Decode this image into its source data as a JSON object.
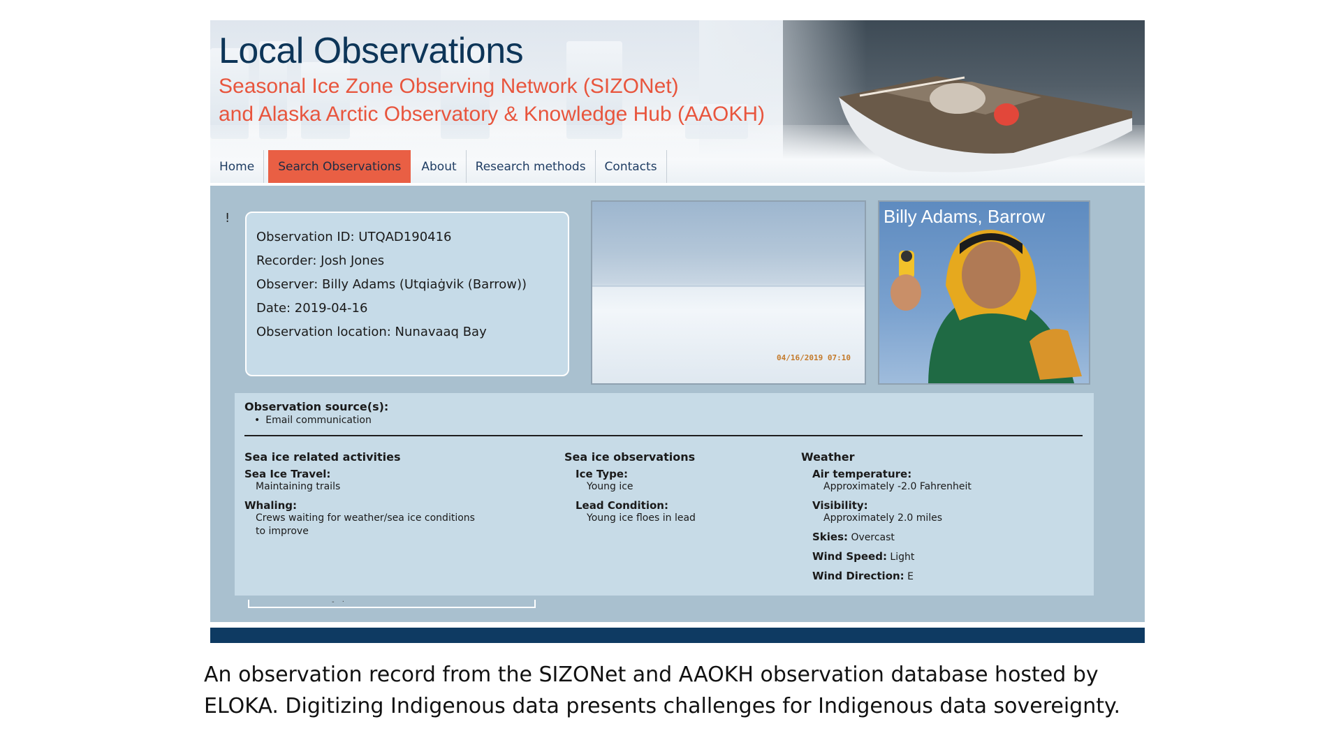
{
  "banner": {
    "title": "Local Observations",
    "subtitle_line1": "Seasonal Ice Zone Observing Network (SIZONet)",
    "subtitle_line2": "and Alaska Arctic Observatory & Knowledge Hub (AAOKH)"
  },
  "nav": {
    "items": [
      {
        "label": "Home"
      },
      {
        "label": "Search Observations",
        "active": true
      },
      {
        "label": "About"
      },
      {
        "label": "Research methods"
      },
      {
        "label": "Contacts"
      }
    ],
    "active_color": "#e95f44"
  },
  "stray_text": "!",
  "record": {
    "id": "Observation ID: UTQAD190416",
    "recorder": "Recorder: Josh Jones",
    "observer": "Observer: Billy Adams (Utqiaġvik (Barrow))",
    "date": "Date: 2019-04-16",
    "location": "Observation location: Nunavaaq Bay"
  },
  "photos": {
    "ice_timestamp": "04/16/2019 07:10",
    "person_caption": "Billy Adams, Barrow"
  },
  "sources": {
    "title": "Observation source(s):",
    "items": [
      "Email communication"
    ]
  },
  "activities": {
    "heading": "Sea ice related activities",
    "travel_label": "Sea Ice Travel:",
    "travel_value": "Maintaining trails",
    "whaling_label": "Whaling:",
    "whaling_value": "Crews waiting for weather/sea ice conditions to improve"
  },
  "ice_obs": {
    "heading": "Sea ice observations",
    "type_label": "Ice Type:",
    "type_value": "Young ice",
    "lead_label": "Lead Condition:",
    "lead_value": "Young ice floes in lead"
  },
  "weather": {
    "heading": "Weather",
    "air_label": "Air temperature:",
    "air_value": "Approximately -2.0 Fahrenheit",
    "vis_label": "Visibility:",
    "vis_value": "Approximately 2.0 miles",
    "skies_label": "Skies:",
    "skies_value": "Overcast",
    "wind_speed_label": "Wind Speed:",
    "wind_speed_value": "Light",
    "wind_dir_label": "Wind Direction:",
    "wind_dir_value": "E"
  },
  "caption": {
    "line1": "An observation record from the SIZONet and AAOKH observation database hosted by",
    "line2": "ELOKA. Digitizing Indigenous data presents challenges for Indigenous data sovereignty."
  }
}
